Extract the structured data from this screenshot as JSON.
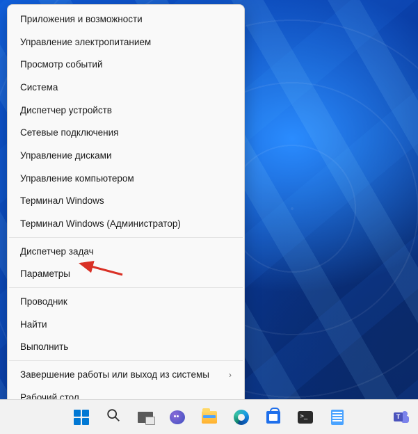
{
  "menu": {
    "groups": [
      [
        {
          "name": "apps-features",
          "label": "Приложения и возможности"
        },
        {
          "name": "power-options",
          "label": "Управление электропитанием"
        },
        {
          "name": "event-viewer",
          "label": "Просмотр событий"
        },
        {
          "name": "system",
          "label": "Система"
        },
        {
          "name": "device-manager",
          "label": "Диспетчер устройств"
        },
        {
          "name": "network-connections",
          "label": "Сетевые подключения"
        },
        {
          "name": "disk-management",
          "label": "Управление дисками"
        },
        {
          "name": "computer-management",
          "label": "Управление компьютером"
        },
        {
          "name": "terminal",
          "label": "Терминал Windows"
        },
        {
          "name": "terminal-admin",
          "label": "Терминал Windows (Администратор)"
        }
      ],
      [
        {
          "name": "task-manager",
          "label": "Диспетчер задач"
        },
        {
          "name": "settings",
          "label": "Параметры"
        }
      ],
      [
        {
          "name": "file-explorer",
          "label": "Проводник"
        },
        {
          "name": "search",
          "label": "Найти"
        },
        {
          "name": "run",
          "label": "Выполнить"
        }
      ],
      [
        {
          "name": "shutdown-signout",
          "label": "Завершение работы или выход из системы",
          "submenu": true
        },
        {
          "name": "desktop",
          "label": "Рабочий стол"
        }
      ]
    ]
  },
  "taskbar": {
    "buttons": [
      {
        "name": "start-button",
        "icon": "windows"
      },
      {
        "name": "search-button",
        "icon": "search"
      },
      {
        "name": "task-view-button",
        "icon": "taskview"
      },
      {
        "name": "chat-button",
        "icon": "chat"
      },
      {
        "name": "file-explorer-button",
        "icon": "explorer"
      },
      {
        "name": "edge-button",
        "icon": "edge"
      },
      {
        "name": "store-button",
        "icon": "store"
      },
      {
        "name": "terminal-button",
        "icon": "terminal"
      },
      {
        "name": "notepad-button",
        "icon": "notepad"
      }
    ],
    "edge_button": {
      "name": "teams-button",
      "icon": "teams"
    }
  },
  "annotations": {
    "arrow_to_settings": true,
    "arrow_to_start": true
  }
}
